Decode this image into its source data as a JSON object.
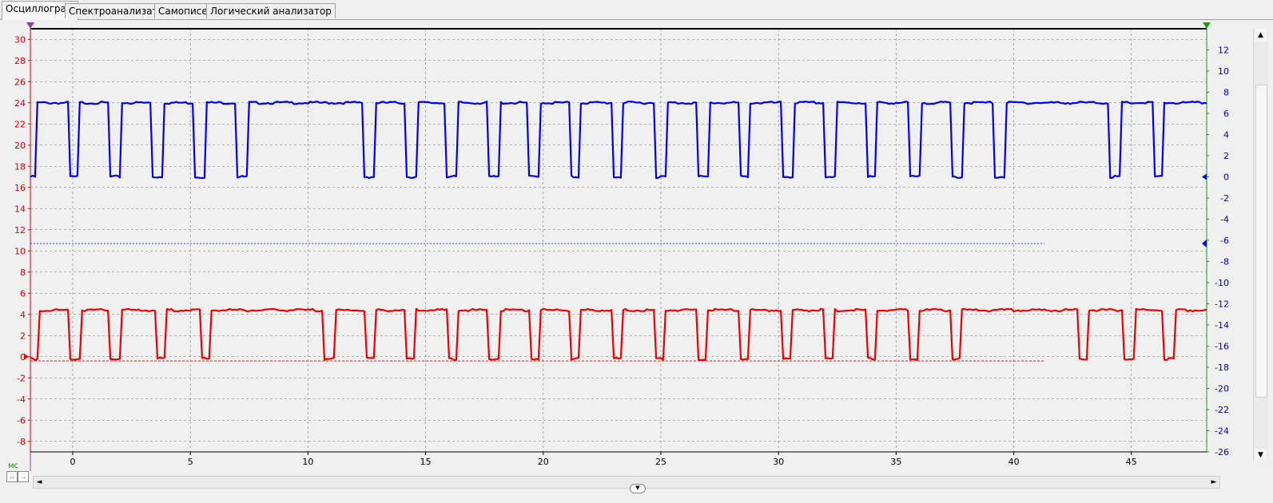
{
  "tabs": [
    "Осциллограф",
    "Спектроанализатор",
    "Самописец",
    "Логический анализатор"
  ],
  "chart_data": {
    "type": "line",
    "xlabel": "мс",
    "xlim": [
      -1.8,
      48.2
    ],
    "x_ticks": [
      0,
      5,
      10,
      15,
      20,
      25,
      30,
      35,
      40,
      45
    ],
    "left_axis": {
      "ylim": [
        -9,
        31
      ],
      "ticks": [
        30,
        28,
        26,
        24,
        22,
        20,
        18,
        16,
        14,
        12,
        10,
        8,
        6,
        4,
        2,
        0,
        -2,
        -4,
        -6,
        -8
      ],
      "color": "#e00000"
    },
    "right_axis": {
      "ylim": [
        -26,
        14
      ],
      "ticks": [
        12,
        10,
        8,
        6,
        4,
        2,
        0,
        -2,
        -4,
        -6,
        -8,
        -10,
        -12,
        -14,
        -16,
        -18,
        -20,
        -22,
        -24,
        -26
      ],
      "color": "#0000cc"
    },
    "series": [
      {
        "color": "#0000ee",
        "axis": "left",
        "high": 24,
        "low": 17,
        "pulses": [
          [
            -1.8,
            -1.5
          ],
          [
            -0.1,
            0.3
          ],
          [
            1.6,
            2.1
          ],
          [
            3.4,
            3.9
          ],
          [
            5.1,
            5.6
          ],
          [
            6.9,
            7.4
          ],
          [
            12.3,
            12.8
          ],
          [
            14.1,
            14.6
          ],
          [
            15.8,
            16.3
          ],
          [
            17.6,
            18.1
          ],
          [
            19.4,
            19.9
          ],
          [
            21.2,
            21.6
          ],
          [
            23.0,
            23.4
          ],
          [
            24.8,
            25.3
          ],
          [
            26.6,
            27.1
          ],
          [
            28.4,
            28.8
          ],
          [
            30.2,
            30.7
          ],
          [
            32.0,
            32.5
          ],
          [
            33.8,
            34.2
          ],
          [
            35.6,
            36.1
          ],
          [
            37.4,
            37.9
          ],
          [
            39.2,
            39.7
          ],
          [
            44.1,
            44.6
          ],
          [
            46.0,
            46.4
          ]
        ]
      },
      {
        "color": "#ee0000",
        "axis": "left",
        "high": 4.4,
        "low": -0.2,
        "pulses": [
          [
            -1.8,
            -1.4
          ],
          [
            -0.1,
            0.4
          ],
          [
            1.6,
            2.1
          ],
          [
            3.6,
            4.0
          ],
          [
            5.4,
            5.8
          ],
          [
            10.6,
            11.1
          ],
          [
            12.4,
            12.8
          ],
          [
            14.1,
            14.5
          ],
          [
            15.9,
            16.3
          ],
          [
            17.6,
            18.1
          ],
          [
            19.5,
            19.9
          ],
          [
            21.2,
            21.6
          ],
          [
            23.0,
            23.4
          ],
          [
            24.8,
            25.2
          ],
          [
            26.6,
            27.0
          ],
          [
            28.4,
            28.8
          ],
          [
            30.2,
            30.6
          ],
          [
            32.0,
            32.4
          ],
          [
            33.8,
            34.2
          ],
          [
            35.6,
            36.0
          ],
          [
            37.4,
            37.8
          ],
          [
            42.8,
            43.2
          ],
          [
            44.7,
            45.2
          ],
          [
            46.4,
            46.9
          ]
        ]
      }
    ]
  },
  "controls": {
    "unit": "мс",
    "ch_a": "..",
    "ch_b": "..",
    "left_arrow": "◄",
    "right_arrow": "►",
    "up_arrow": "▲",
    "down_arrow": "▼",
    "collapse": "▼"
  }
}
